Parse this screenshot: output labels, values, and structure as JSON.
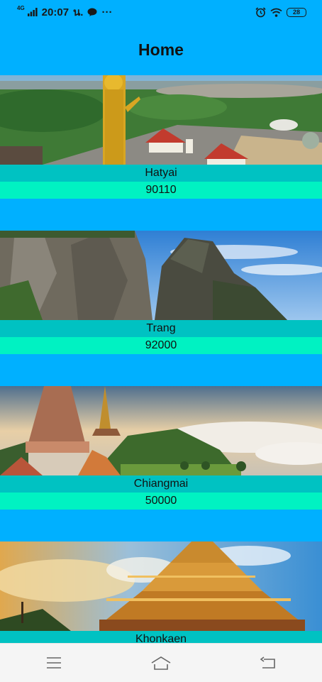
{
  "status_bar": {
    "network": "4G",
    "time": "20:07",
    "carrier": "น.",
    "more": "···",
    "battery": "28"
  },
  "app_bar": {
    "title": "Home"
  },
  "places": [
    {
      "name": "Hatyai",
      "zip": "90110"
    },
    {
      "name": "Trang",
      "zip": "92000"
    },
    {
      "name": "Chiangmai",
      "zip": "50000"
    },
    {
      "name": "Khonkaen",
      "zip": ""
    }
  ],
  "icons": {
    "menu": "menu-icon",
    "home": "home-icon",
    "back": "back-icon",
    "alarm": "alarm-icon",
    "wifi": "wifi-icon",
    "signal": "signal-icon",
    "line_app": "line-app-icon"
  },
  "colors": {
    "background": "#00b0ff",
    "name_bar": "#00c2c2",
    "zip_bar": "#00f2c2",
    "nav_bar": "#f5f5f5"
  }
}
